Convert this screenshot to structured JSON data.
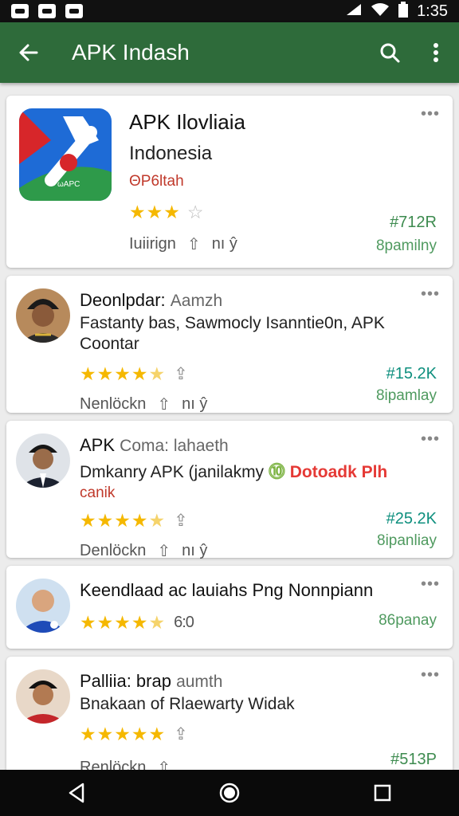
{
  "status_bar": {
    "time": "1:35"
  },
  "appbar": {
    "title": "APK Indash"
  },
  "featured": {
    "title": "APK Ilovliaia",
    "subtitle": "Indonesia",
    "tag": "ΘΡ6ltah",
    "rating": 3,
    "meta_left": "Iuiirign",
    "meta_right": "nı ŷ",
    "price": "#712R",
    "price_sub": "8pamilny"
  },
  "items": [
    {
      "title": "Deonlpdar:",
      "title_sub": "Aamzh",
      "line1": "Fastanty bas, Sawmocly Isanntie0n, APK",
      "line2": "Coontar",
      "rating": 4.5,
      "meta_left": "Nenlöckn",
      "meta_right": "nı ŷ",
      "price": "#15.2K",
      "price_sub": "8ipamlay"
    },
    {
      "title": "APK",
      "title_sub": "Coma: lahaeth",
      "line1": "Dmkanry APK (janilakmy",
      "line1_badge": "Dotoadk Plh",
      "line2": "canik",
      "rating": 4.5,
      "meta_left": "Denlöckn",
      "meta_right": "nı ŷ",
      "price": "#25.2K",
      "price_sub": "8ipanliay"
    },
    {
      "title": "Keendlaad ac lauiahs Png Nonnpiann",
      "rating": 4.5,
      "rating_count": "6:0",
      "price_sub": "86panay"
    },
    {
      "title": "Palliia: brap",
      "title_sub": "aumth",
      "line1": "Bnakaan of Rlaewarty Widak",
      "rating": 5,
      "meta_left": "Renlöckn",
      "price": "#513P"
    }
  ],
  "colors": {
    "appbar": "#2e6b3a",
    "star": "#f5b800",
    "price_green": "#3d8b4f",
    "price_teal": "#0e8f7e",
    "tag_red": "#c0392b"
  },
  "icons": {
    "back": "arrow-left-icon",
    "search": "search-icon",
    "overflow": "more-vert-icon",
    "nav_back": "nav-back-icon",
    "nav_home": "nav-home-icon",
    "nav_recents": "nav-recents-icon"
  }
}
